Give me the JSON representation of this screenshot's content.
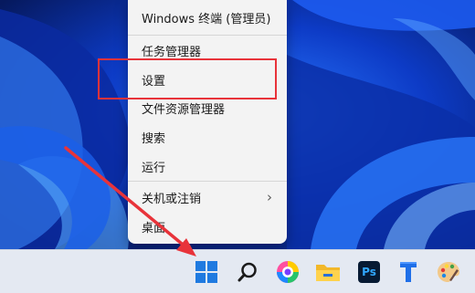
{
  "context_menu": {
    "items": [
      {
        "label": "Windows 终端 (管理员)"
      },
      {
        "label": "任务管理器"
      },
      {
        "label": "设置"
      },
      {
        "label": "文件资源管理器"
      },
      {
        "label": "搜索"
      },
      {
        "label": "运行"
      },
      {
        "label": "关机或注销"
      },
      {
        "label": "桌面"
      }
    ],
    "submenu_indicator": "›"
  },
  "taskbar": {
    "icons": [
      "windows-start-icon",
      "search-icon",
      "browser-icon",
      "file-explorer-icon",
      "photoshop-icon",
      "typora-icon",
      "paint-icon"
    ],
    "photoshop_label": "Ps"
  },
  "colors": {
    "highlight_border": "#e8333a",
    "arrow": "#e8333a",
    "menu_bg": "#f3f3f3",
    "taskbar_bg": "#e4e9f2",
    "start_blue": "#1f7ae0"
  }
}
